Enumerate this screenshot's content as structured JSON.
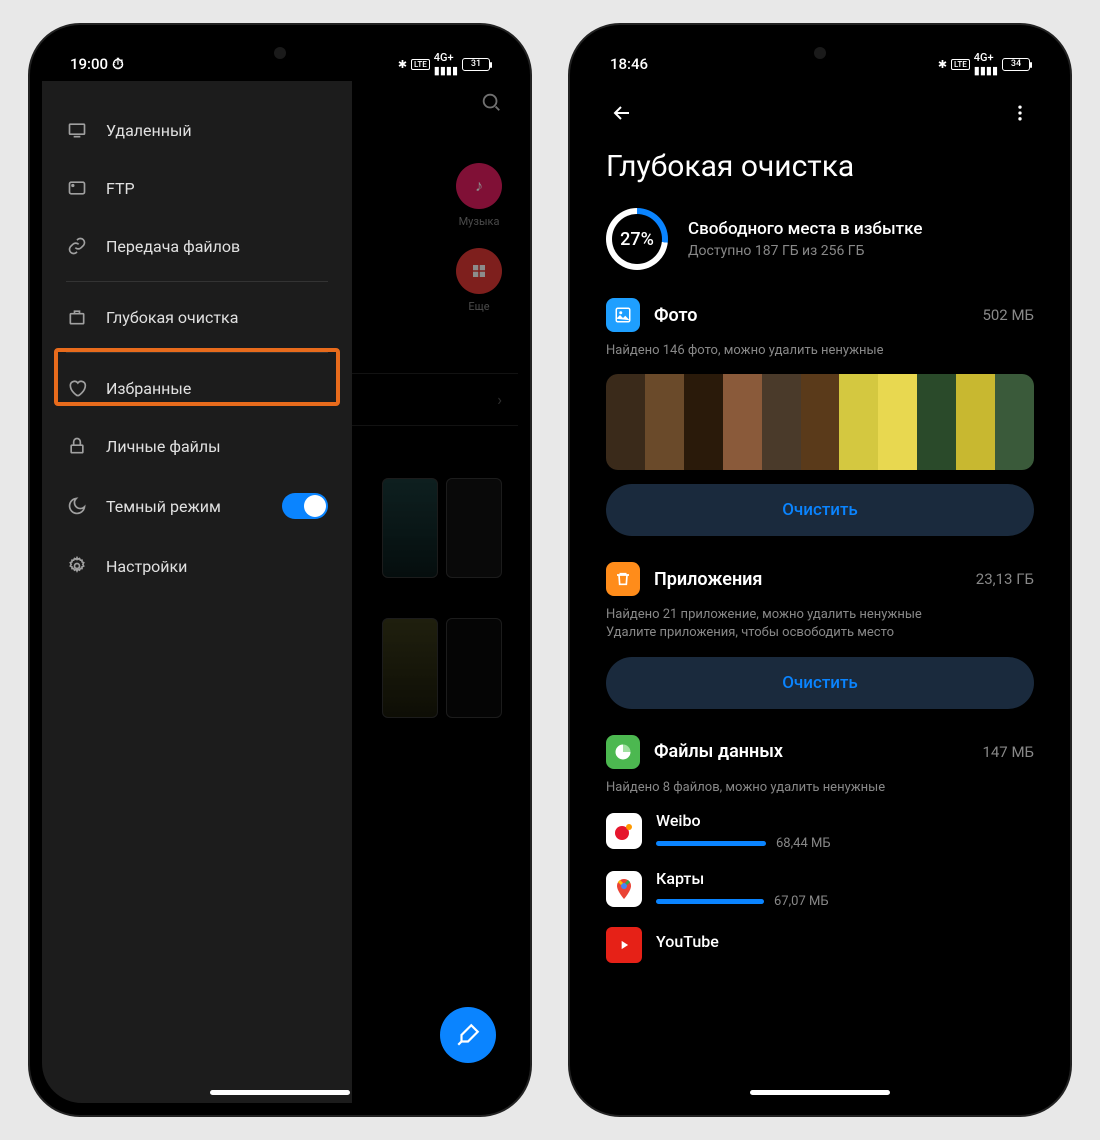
{
  "left": {
    "time": "19:00",
    "battery": "31",
    "drawer": {
      "remote": "Удаленный",
      "ftp": "FTP",
      "transfer": "Передача файлов",
      "deepclean": "Глубокая очистка",
      "favorites": "Избранные",
      "private": "Личные файлы",
      "darkmode": "Темный режим",
      "settings": "Настройки"
    },
    "bg": {
      "music": "Музыка",
      "more": "Еще"
    }
  },
  "right": {
    "time": "18:46",
    "battery": "34",
    "title": "Глубокая очистка",
    "storage": {
      "percent": "27%",
      "line1": "Свободного места в избытке",
      "line2": "Доступно 187 ГБ из 256 ГБ"
    },
    "photo": {
      "title": "Фото",
      "size": "502 МБ",
      "sub": "Найдено 146 фото, можно удалить ненужные",
      "btn": "Очистить"
    },
    "apps": {
      "title": "Приложения",
      "size": "23,13 ГБ",
      "sub1": "Найдено 21 приложение, можно удалить ненужные",
      "sub2": "Удалите приложения, чтобы освободить место",
      "btn": "Очистить"
    },
    "data": {
      "title": "Файлы данных",
      "size": "147 МБ",
      "sub": "Найдено 8 файлов, можно удалить ненужные",
      "items": [
        {
          "name": "Weibo",
          "size": "68,44 МБ",
          "bar": 110
        },
        {
          "name": "Карты",
          "size": "67,07 МБ",
          "bar": 108
        },
        {
          "name": "YouTube",
          "size": "",
          "bar": 0
        }
      ]
    }
  }
}
